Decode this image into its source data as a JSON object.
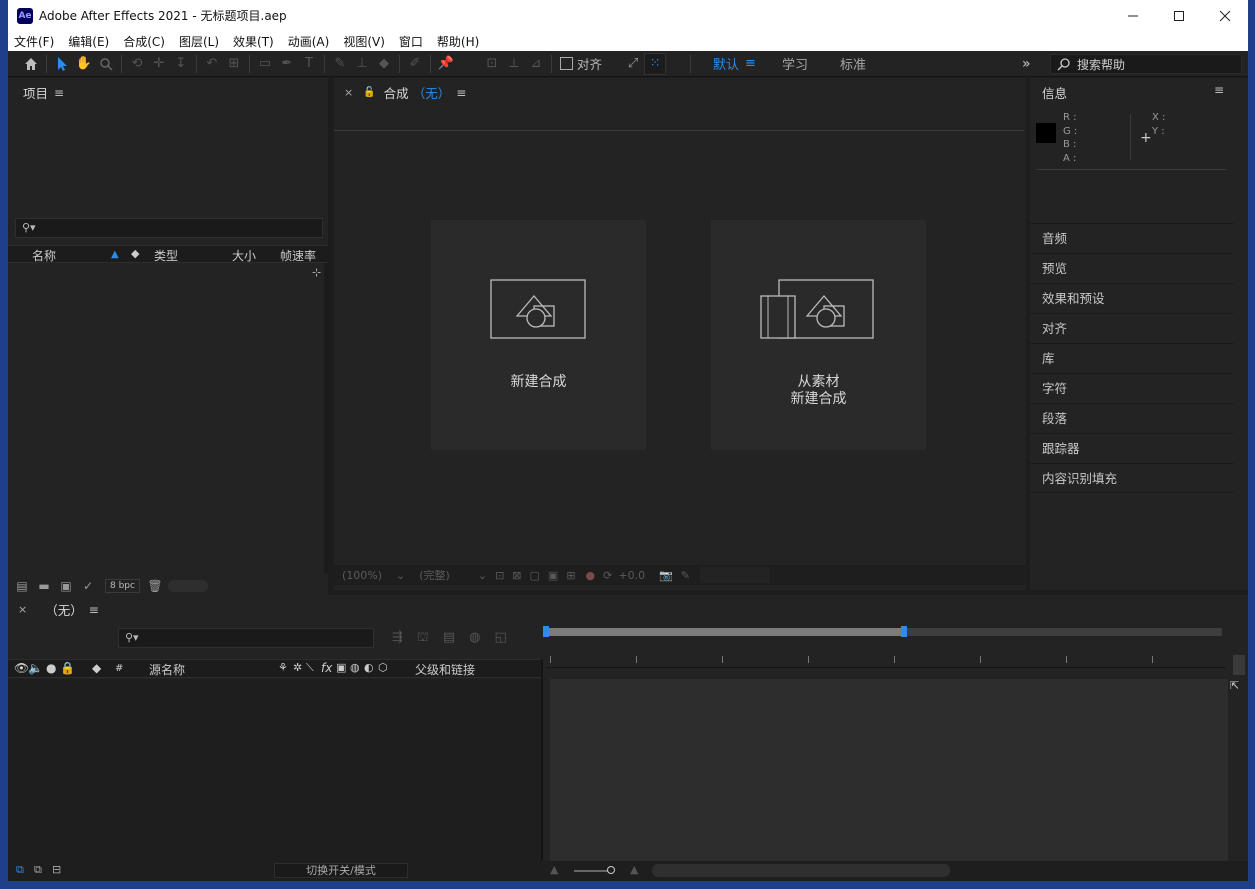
{
  "window": {
    "app_logo": "Ae",
    "title": "Adobe After Effects 2021 - 无标题项目.aep",
    "controls": [
      "minimize-icon",
      "maximize-icon",
      "close-icon"
    ]
  },
  "menu": [
    "文件(F)",
    "编辑(E)",
    "合成(C)",
    "图层(L)",
    "效果(T)",
    "动画(A)",
    "视图(V)",
    "窗口",
    "帮助(H)"
  ],
  "toolbar": {
    "snap_label": "对齐",
    "workspaces": [
      "默认",
      "学习",
      "标准"
    ],
    "active_workspace": "默认",
    "search_placeholder": "搜索帮助"
  },
  "project": {
    "title": "项目",
    "search_placeholder": "",
    "columns": {
      "name": "名称",
      "type": "类型",
      "size": "大小",
      "fps": "帧速率"
    },
    "bpc": "8 bpc"
  },
  "composition": {
    "title": "合成",
    "comp_name": "（无）",
    "new_comp_label": "新建合成",
    "from_footage_line1": "从素材",
    "from_footage_line2": "新建合成",
    "zoom": "(100%)",
    "quality": "(完整)",
    "exposure": "+0.0"
  },
  "info": {
    "title": "信息",
    "channels": [
      "R :",
      "G :",
      "B :",
      "A :"
    ],
    "coords": [
      "X :",
      "Y :"
    ]
  },
  "side_panels": [
    "音频",
    "预览",
    "效果和预设",
    "对齐",
    "库",
    "字符",
    "段落",
    "跟踪器",
    "内容识别填充"
  ],
  "timeline": {
    "title": "（无）",
    "columns": {
      "num": "#",
      "source_name": "源名称",
      "fx": "fx",
      "parent": "父级和链接"
    },
    "toggle_label": "切换开关/模式"
  },
  "colors": {
    "accent": "#2d8ceb",
    "panel": "#232323",
    "bg": "#1d1d1d"
  }
}
